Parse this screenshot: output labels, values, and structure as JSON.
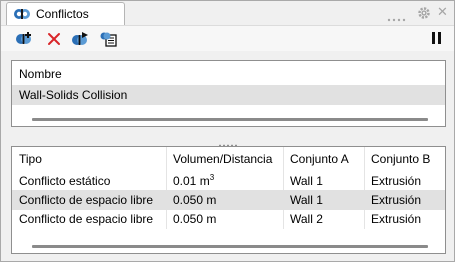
{
  "window": {
    "title": "Conflictos"
  },
  "toolbar": {
    "buttons": [
      {
        "icon": "add-conflict-icon"
      },
      {
        "icon": "delete-icon"
      },
      {
        "icon": "run-conflict-icon"
      },
      {
        "icon": "report-icon"
      }
    ],
    "pause_icon": "pause-icon"
  },
  "tests": {
    "header": "Nombre",
    "rows": [
      {
        "name": "Wall-Solids Collision"
      }
    ]
  },
  "results": {
    "columns": [
      "Tipo",
      "Volumen/Distancia",
      "Conjunto A",
      "Conjunto B"
    ],
    "rows": [
      {
        "tipo": "Conflicto estático",
        "valor": "0.01 m",
        "unit_sup": "3",
        "a": "Wall 1",
        "b": "Extrusión"
      },
      {
        "tipo": "Conflicto de espacio libre",
        "valor": "0.050 m",
        "unit_sup": "",
        "a": "Wall 1",
        "b": "Extrusión"
      },
      {
        "tipo": "Conflicto de espacio libre",
        "valor": "0.050 m",
        "unit_sup": "",
        "a": "Wall 2",
        "b": "Extrusión"
      }
    ]
  },
  "colors": {
    "selected_row": "#e1e1e1",
    "border": "#8f8f8f",
    "accent_blue": "#2b6fb6",
    "delete_red": "#d9262a"
  }
}
